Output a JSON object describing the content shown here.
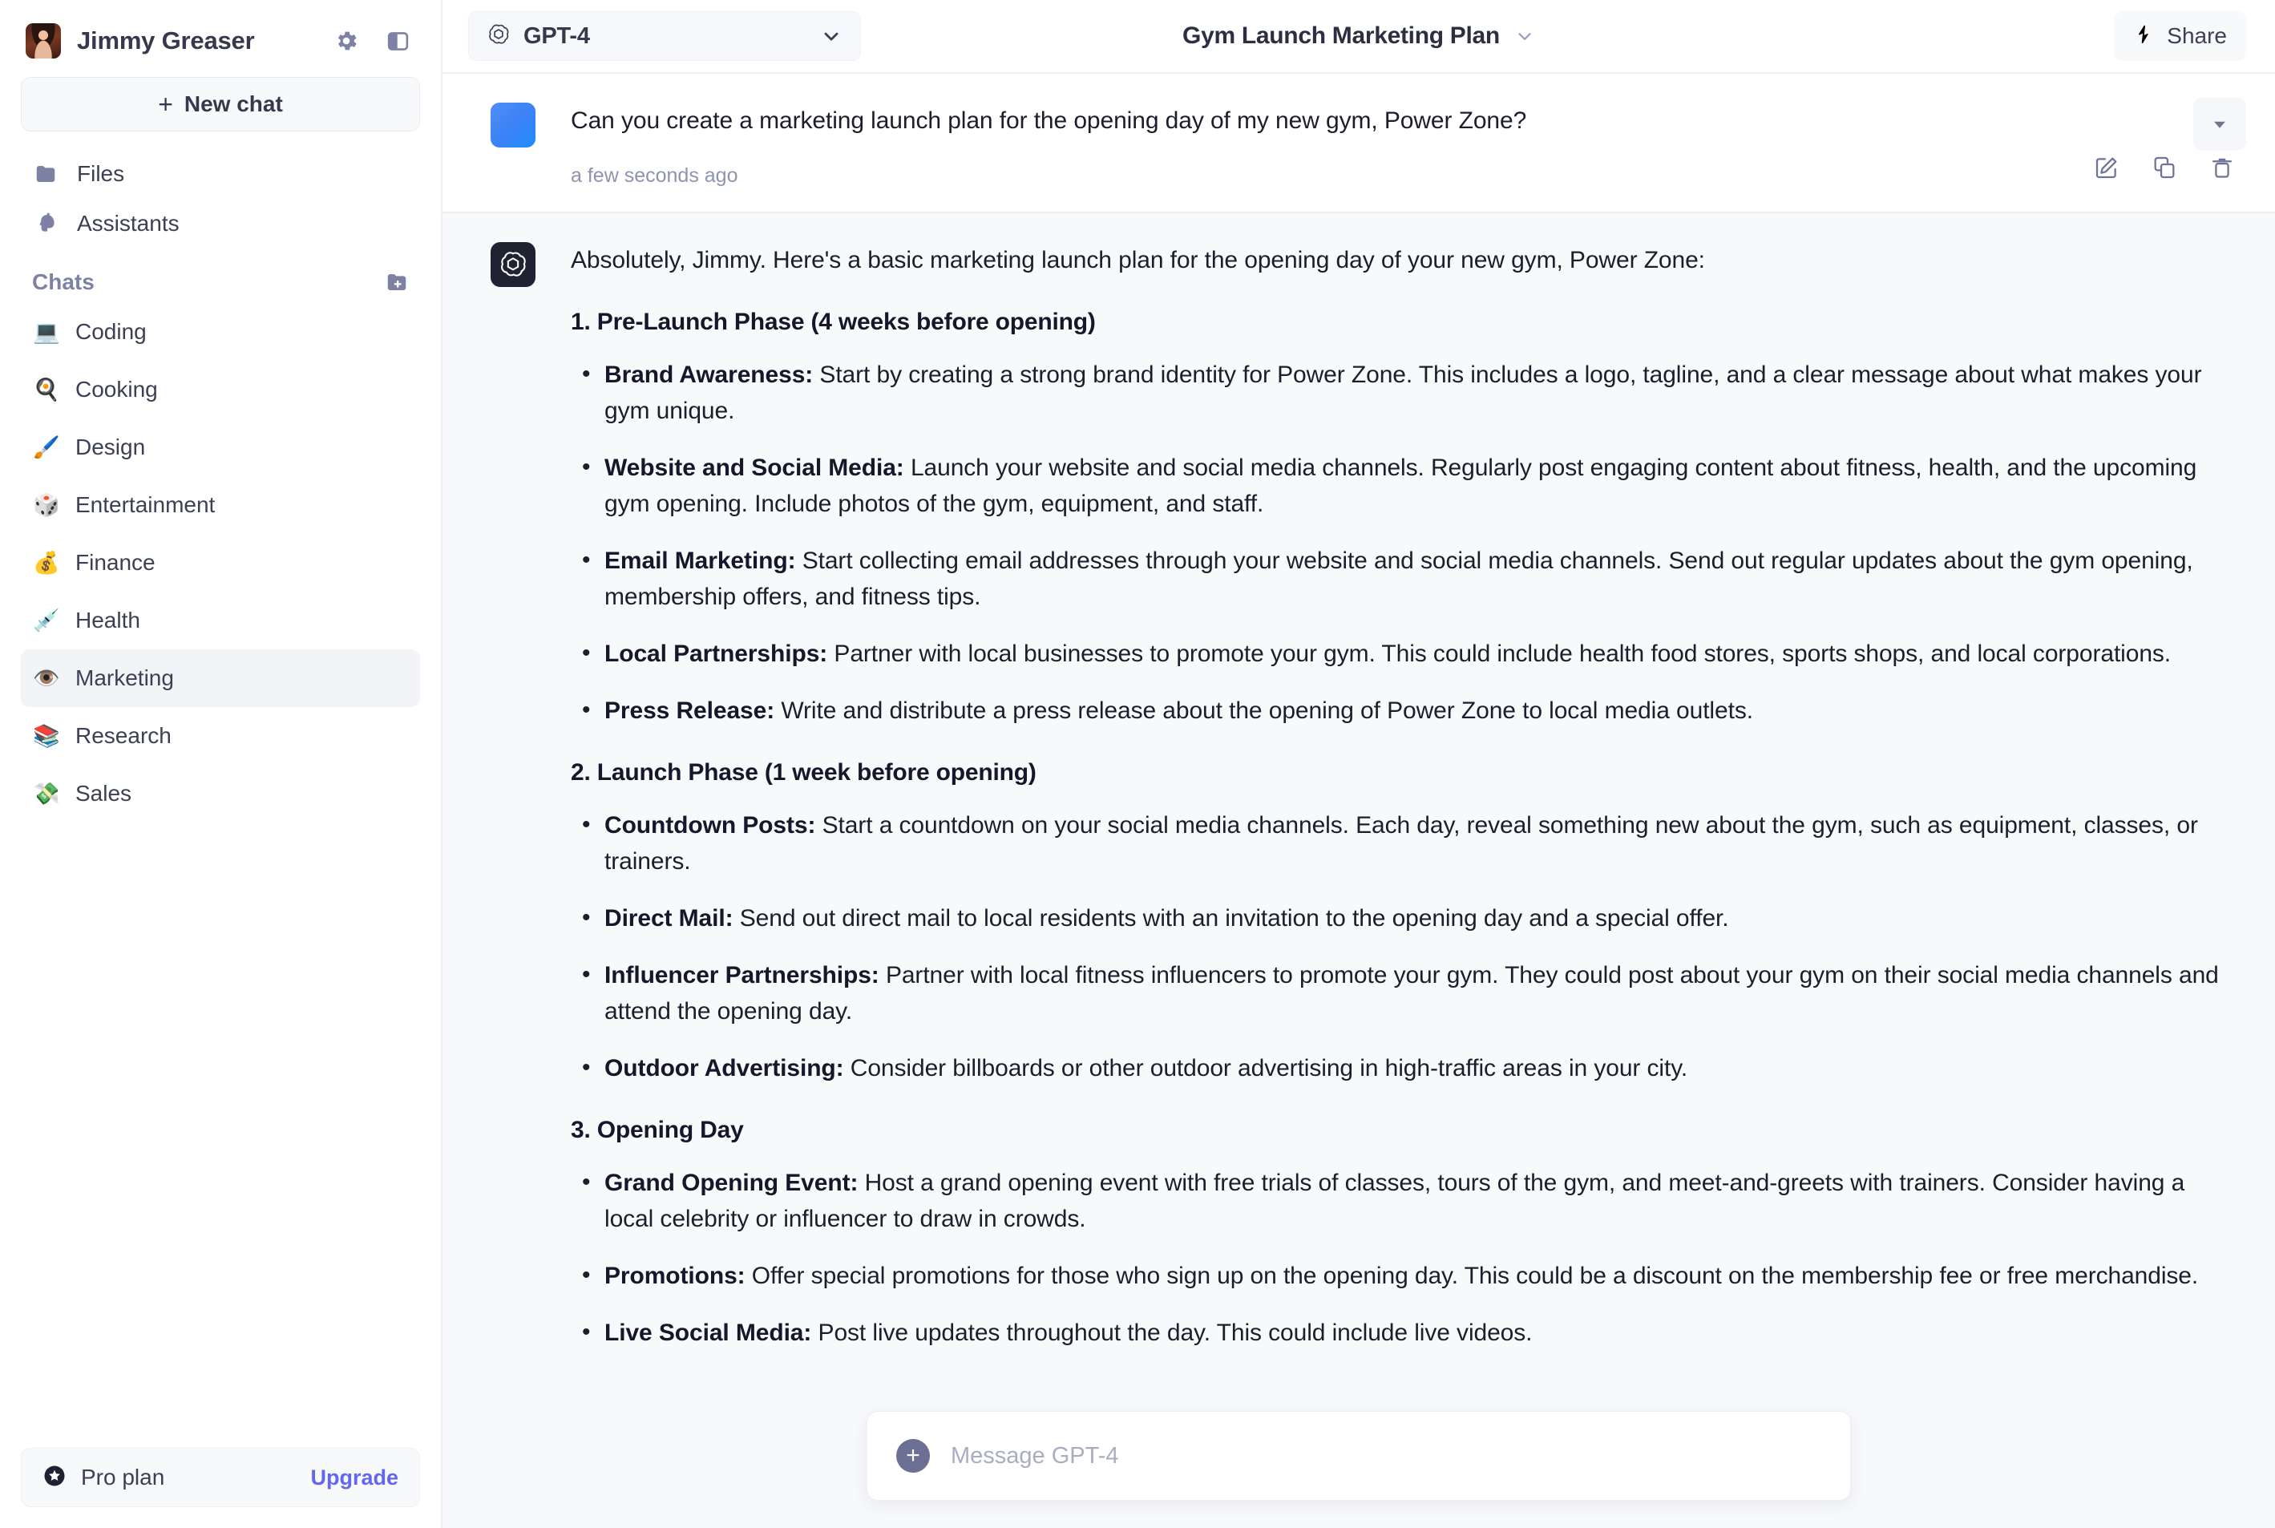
{
  "sidebar": {
    "user": {
      "name": "Jimmy Greaser",
      "avatar_alt": "user-photo"
    },
    "settings_icon": "gear-icon",
    "panel_toggle_icon": "sidebar-toggle-icon",
    "new_chat": {
      "label": "New chat",
      "plus": "+"
    },
    "nav": [
      {
        "label": "Files",
        "icon": "folder-icon"
      },
      {
        "label": "Assistants",
        "icon": "assistant-head-icon"
      }
    ],
    "chats_section": {
      "title": "Chats",
      "add_icon": "new-folder-icon"
    },
    "chats": [
      {
        "label": "Coding",
        "emoji": "💻",
        "active": false
      },
      {
        "label": "Cooking",
        "emoji": "🍳",
        "active": false
      },
      {
        "label": "Design",
        "emoji": "🖌️",
        "active": false
      },
      {
        "label": "Entertainment",
        "emoji": "🎲",
        "active": false
      },
      {
        "label": "Finance",
        "emoji": "💰",
        "active": false
      },
      {
        "label": "Health",
        "emoji": "💉",
        "active": false
      },
      {
        "label": "Marketing",
        "emoji": "👁️",
        "active": true
      },
      {
        "label": "Research",
        "emoji": "📚",
        "active": false
      },
      {
        "label": "Sales",
        "emoji": "💸",
        "active": false
      }
    ],
    "plan": {
      "icon": "star-badge-icon",
      "label": "Pro plan",
      "upgrade": "Upgrade"
    }
  },
  "topbar": {
    "model": {
      "name": "GPT-4",
      "icon": "openai-logo-icon",
      "chevron": "chevron-down-icon"
    },
    "conversation_title": "Gym Launch Marketing Plan",
    "title_chevron": "chevron-down-icon",
    "share": {
      "label": "Share",
      "icon": "share-arrow-icon"
    }
  },
  "conversation": {
    "user_message": {
      "text": "Can you create a marketing launch plan for the opening day of my new gym, Power Zone?",
      "timestamp": "a few seconds ago",
      "actions": [
        {
          "name": "edit-icon"
        },
        {
          "name": "copy-icon"
        },
        {
          "name": "delete-icon"
        }
      ],
      "collapse_icon": "caret-down-icon"
    },
    "assistant_message": {
      "avatar_icon": "openai-logo-icon",
      "intro": "Absolutely, Jimmy. Here's a basic marketing launch plan for the opening day of your new gym, Power Zone:",
      "sections": [
        {
          "heading": "1. Pre-Launch Phase (4 weeks before opening)",
          "points": [
            {
              "term": "Brand Awareness:",
              "text": " Start by creating a strong brand identity for Power Zone. This includes a logo, tagline, and a clear message about what makes your gym unique."
            },
            {
              "term": "Website and Social Media:",
              "text": " Launch your website and social media channels. Regularly post engaging content about fitness, health, and the upcoming gym opening. Include photos of the gym, equipment, and staff."
            },
            {
              "term": "Email Marketing:",
              "text": " Start collecting email addresses through your website and social media channels. Send out regular updates about the gym opening, membership offers, and fitness tips."
            },
            {
              "term": "Local Partnerships:",
              "text": " Partner with local businesses to promote your gym. This could include health food stores, sports shops, and local corporations."
            },
            {
              "term": "Press Release:",
              "text": " Write and distribute a press release about the opening of Power Zone to local media outlets."
            }
          ]
        },
        {
          "heading": "2. Launch Phase (1 week before opening)",
          "points": [
            {
              "term": "Countdown Posts:",
              "text": " Start a countdown on your social media channels. Each day, reveal something new about the gym, such as equipment, classes, or trainers."
            },
            {
              "term": "Direct Mail:",
              "text": " Send out direct mail to local residents with an invitation to the opening day and a special offer."
            },
            {
              "term": "Influencer Partnerships:",
              "text": " Partner with local fitness influencers to promote your gym. They could post about your gym on their social media channels and attend the opening day."
            },
            {
              "term": "Outdoor Advertising:",
              "text": " Consider billboards or other outdoor advertising in high-traffic areas in your city."
            }
          ]
        },
        {
          "heading": "3. Opening Day",
          "points": [
            {
              "term": "Grand Opening Event:",
              "text": " Host a grand opening event with free trials of classes, tours of the gym, and meet-and-greets with trainers. Consider having a local celebrity or influencer to draw in crowds."
            },
            {
              "term": "Promotions:",
              "text": " Offer special promotions for those who sign up on the opening day. This could be a discount on the membership fee or free merchandise."
            },
            {
              "term": "Live Social Media:",
              "text": " Post live updates throughout the day. This could include live videos."
            }
          ]
        }
      ]
    }
  },
  "composer": {
    "placeholder": "Message GPT-4",
    "value": "",
    "attach_icon": "plus-circle-icon"
  },
  "colors": {
    "accent_blue": "#3b82f6",
    "upgrade_purple": "#6366f1",
    "sidebar_bg": "#ffffff",
    "main_bg": "#f8f9fb",
    "text_primary": "#1c1e2b",
    "text_muted": "#7d82a5"
  }
}
